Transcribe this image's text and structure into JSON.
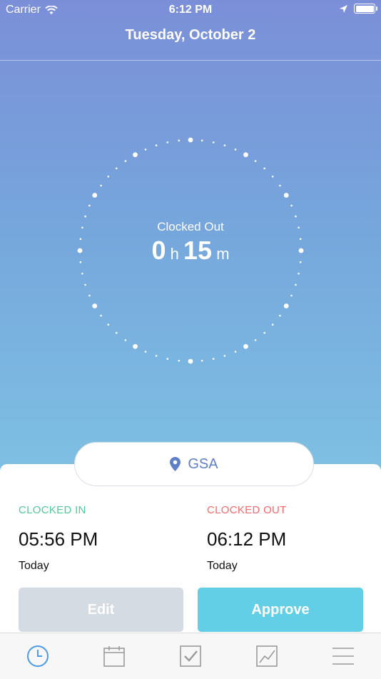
{
  "status_bar": {
    "carrier": "Carrier",
    "time": "6:12 PM"
  },
  "header": {
    "title": "Tuesday, October 2"
  },
  "timer": {
    "status": "Clocked Out",
    "hours": "0",
    "hours_unit": "h",
    "minutes": "15",
    "minutes_unit": "m"
  },
  "location": {
    "name": "GSA",
    "icon": "map-pin-icon"
  },
  "clocked_in": {
    "label": "CLOCKED IN",
    "time": "05:56 PM",
    "day": "Today",
    "color": "#4fc99a"
  },
  "clocked_out": {
    "label": "CLOCKED OUT",
    "time": "06:12 PM",
    "day": "Today",
    "color": "#f26a6a"
  },
  "actions": {
    "edit_label": "Edit",
    "approve_label": "Approve"
  },
  "tab_bar": {
    "items": [
      {
        "icon": "clock-icon",
        "active": true
      },
      {
        "icon": "calendar-icon",
        "active": false
      },
      {
        "icon": "checkbox-icon",
        "active": false
      },
      {
        "icon": "chart-icon",
        "active": false
      },
      {
        "icon": "menu-icon",
        "active": false
      }
    ]
  },
  "colors": {
    "accent": "#4a9be8",
    "tab_inactive": "#9a9a9a"
  }
}
